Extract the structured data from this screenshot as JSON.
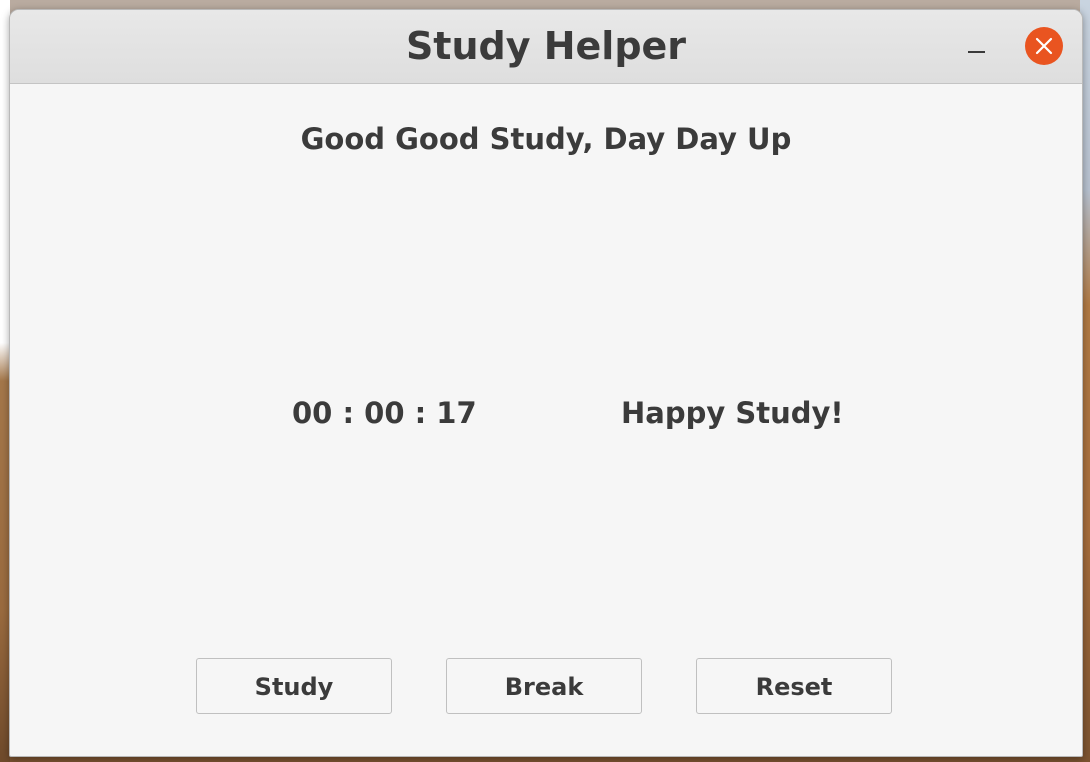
{
  "window": {
    "title": "Study Helper"
  },
  "main": {
    "motto": "Good Good Study, Day Day Up",
    "timer": "00 : 00 : 17",
    "status": "Happy Study!"
  },
  "buttons": {
    "study_label": "Study",
    "break_label": "Break",
    "reset_label": "Reset"
  },
  "colors": {
    "close_button": "#e95420",
    "window_bg": "#f6f6f6",
    "titlebar_bg": "#dedede",
    "text": "#3b3b3b"
  },
  "icons": {
    "minimize": "minimize-icon",
    "close": "close-icon"
  }
}
